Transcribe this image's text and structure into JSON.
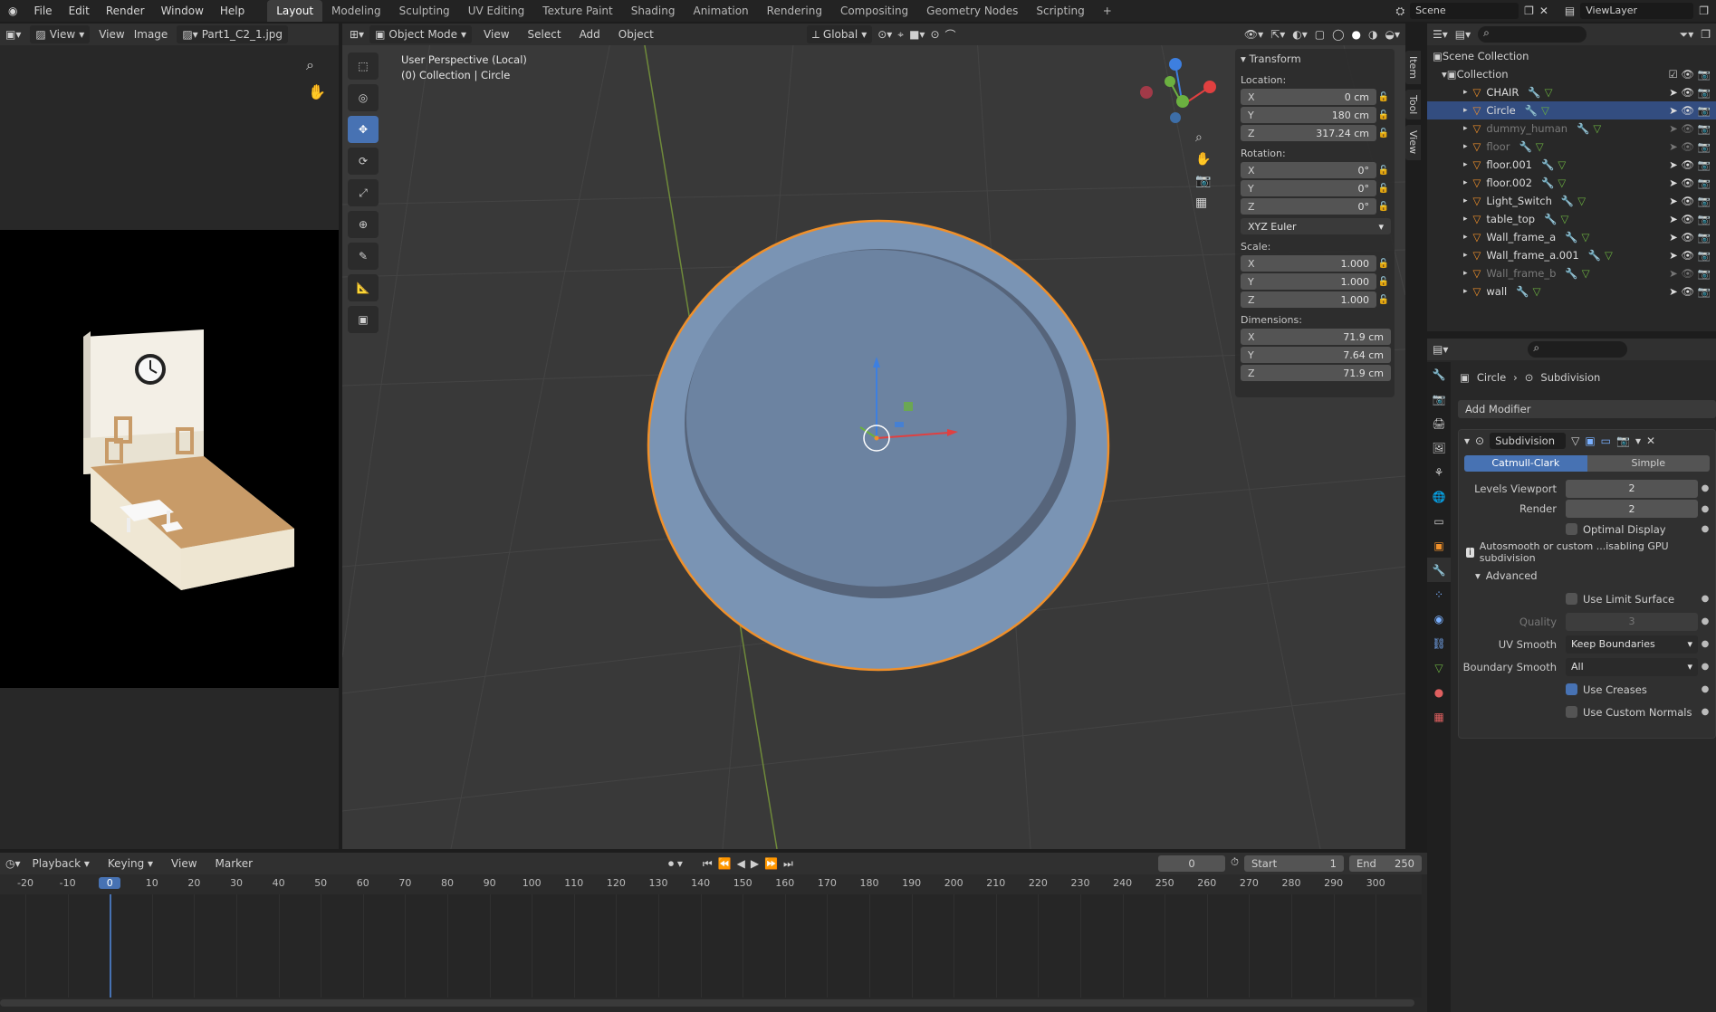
{
  "menu": [
    "File",
    "Edit",
    "Render",
    "Window",
    "Help"
  ],
  "workspaces": [
    "Layout",
    "Modeling",
    "Sculpting",
    "UV Editing",
    "Texture Paint",
    "Shading",
    "Animation",
    "Rendering",
    "Compositing",
    "Geometry Nodes",
    "Scripting"
  ],
  "active_workspace": "Layout",
  "scene": {
    "label": "Scene",
    "viewlayer": "ViewLayer"
  },
  "image_editor": {
    "view": "View",
    "menu_view": "View",
    "menu_image": "Image",
    "image_name": "Part1_C2_1.jpg"
  },
  "viewport": {
    "mode": "Object Mode",
    "menus": [
      "View",
      "Select",
      "Add",
      "Object"
    ],
    "orientation": "Global",
    "overlay_title": "User Perspective (Local)",
    "overlay_sub": "(0) Collection | Circle"
  },
  "side_tabs": [
    "Item",
    "Tool",
    "View"
  ],
  "npanel": {
    "title": "Transform",
    "location_label": "Location:",
    "location": [
      {
        "axis": "X",
        "value": "0 cm"
      },
      {
        "axis": "Y",
        "value": "180 cm"
      },
      {
        "axis": "Z",
        "value": "317.24 cm"
      }
    ],
    "rotation_label": "Rotation:",
    "rotation": [
      {
        "axis": "X",
        "value": "0°"
      },
      {
        "axis": "Y",
        "value": "0°"
      },
      {
        "axis": "Z",
        "value": "0°"
      }
    ],
    "rotation_mode": "XYZ Euler",
    "scale_label": "Scale:",
    "scale": [
      {
        "axis": "X",
        "value": "1.000"
      },
      {
        "axis": "Y",
        "value": "1.000"
      },
      {
        "axis": "Z",
        "value": "1.000"
      }
    ],
    "dimensions_label": "Dimensions:",
    "dimensions": [
      {
        "axis": "X",
        "value": "71.9 cm"
      },
      {
        "axis": "Y",
        "value": "7.64 cm"
      },
      {
        "axis": "Z",
        "value": "71.9 cm"
      }
    ]
  },
  "outliner": {
    "root": "Scene Collection",
    "collection": "Collection",
    "items": [
      {
        "name": "CHAIR",
        "dim": false,
        "selected": false
      },
      {
        "name": "Circle",
        "dim": false,
        "selected": true
      },
      {
        "name": "dummy_human",
        "dim": true,
        "selected": false
      },
      {
        "name": "floor",
        "dim": true,
        "selected": false
      },
      {
        "name": "floor.001",
        "dim": false,
        "selected": false
      },
      {
        "name": "floor.002",
        "dim": false,
        "selected": false
      },
      {
        "name": "Light_Switch",
        "dim": false,
        "selected": false
      },
      {
        "name": "table_top",
        "dim": false,
        "selected": false
      },
      {
        "name": "Wall_frame_a",
        "dim": false,
        "selected": false
      },
      {
        "name": "Wall_frame_a.001",
        "dim": false,
        "selected": false
      },
      {
        "name": "Wall_frame_b",
        "dim": true,
        "selected": false
      },
      {
        "name": "wall",
        "dim": false,
        "selected": false
      }
    ]
  },
  "properties": {
    "breadcrumb_object": "Circle",
    "breadcrumb_modifier": "Subdivision",
    "add_modifier": "Add Modifier",
    "modifier_name": "Subdivision",
    "type_a": "Catmull-Clark",
    "type_b": "Simple",
    "levels_viewport_label": "Levels Viewport",
    "levels_viewport": "2",
    "render_label": "Render",
    "render": "2",
    "optimal_display": "Optimal Display",
    "warning": "Autosmooth or custom ...isabling GPU subdivision",
    "advanced": "Advanced",
    "use_limit_surface": "Use Limit Surface",
    "quality_label": "Quality",
    "quality": "3",
    "uv_smooth_label": "UV Smooth",
    "uv_smooth": "Keep Boundaries",
    "boundary_smooth_label": "Boundary Smooth",
    "boundary_smooth": "All",
    "use_creases": "Use Creases",
    "use_custom_normals": "Use Custom Normals"
  },
  "timeline": {
    "menus": [
      "Playback",
      "Keying",
      "View",
      "Marker"
    ],
    "current_frame": "0",
    "start_label": "Start",
    "start": "1",
    "end_label": "End",
    "end": "250",
    "ticks": [
      "-20",
      "-10",
      "0",
      "10",
      "20",
      "30",
      "40",
      "50",
      "60",
      "70",
      "80",
      "90",
      "100",
      "110",
      "120",
      "130",
      "140",
      "150",
      "160",
      "170",
      "180",
      "190",
      "200",
      "210",
      "220",
      "230",
      "240",
      "250",
      "260",
      "270",
      "280",
      "290",
      "300"
    ]
  },
  "colors": {
    "accent": "#4772b3",
    "selection_outline": "#f0902a",
    "mesh": "#7a94b4"
  }
}
